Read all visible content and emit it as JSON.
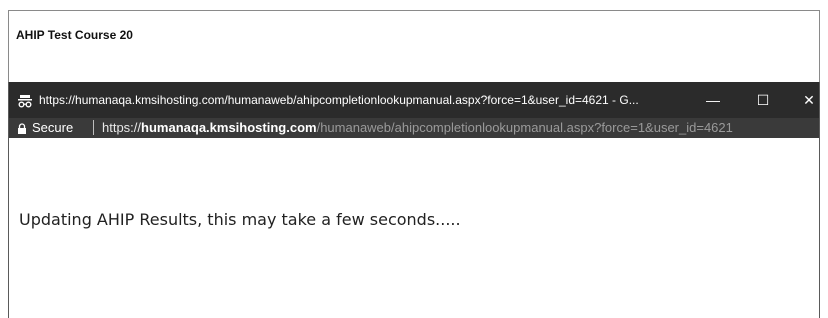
{
  "background_page": {
    "title": "AHIP Test Course 20"
  },
  "popup": {
    "window_title": "https://humanaqa.kmsihosting.com/humanaweb/ahipcompletionlookupmanual.aspx?force=1&user_id=4621 - G...",
    "controls": {
      "minimize": "—",
      "maximize": "☐",
      "close": "✕"
    },
    "address_bar": {
      "secure_label": "Secure",
      "url_scheme": "https://",
      "url_host": "humanaqa.kmsihosting.com",
      "url_path": "/humanaweb/ahipcompletionlookupmanual.aspx?force=1&user_id=4621"
    },
    "message": "Updating AHIP Results, this may take a few seconds....."
  },
  "icons": {
    "window_icon": "incognito-icon",
    "lock": "lock-icon"
  },
  "colors": {
    "titlebar": "#2b2b2b",
    "addressbar": "#3a3a3a",
    "url_path": "#9a9a9a"
  }
}
